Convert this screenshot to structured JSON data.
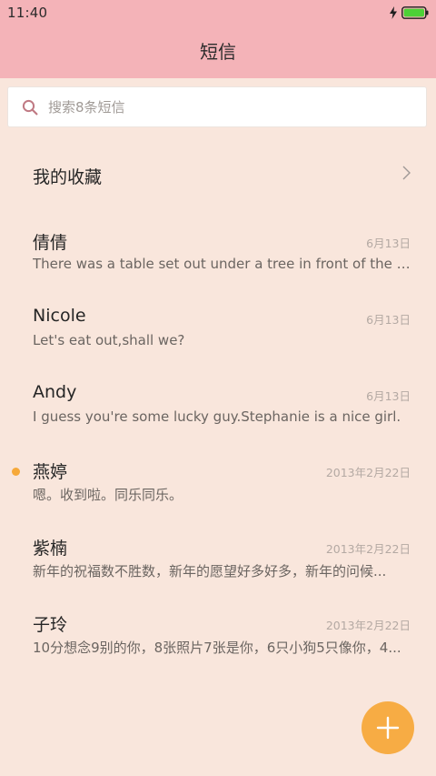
{
  "status_bar": {
    "time": "11:40",
    "icons": [
      "charging-icon",
      "battery-icon"
    ],
    "battery_color": "#4cd137"
  },
  "header": {
    "title": "短信",
    "background": "#f4b3b8"
  },
  "search": {
    "placeholder": "搜索8条短信",
    "icon": "search-icon"
  },
  "favorites": {
    "label": "我的收藏",
    "icon": "chevron-right-icon"
  },
  "conversations": [
    {
      "name": "倩倩",
      "date": "6月13日",
      "preview": "There was a table set out under a tree in front of the ho...",
      "unread": false
    },
    {
      "name": "Nicole",
      "date": "6月13日",
      "preview": "Let's eat out,shall we?",
      "unread": false
    },
    {
      "name": "Andy",
      "date": "6月13日",
      "preview": "I guess you're some lucky guy.Stephanie is a nice girl.",
      "unread": false
    },
    {
      "name": "燕婷",
      "date": "2013年2月22日",
      "preview": "嗯。收到啦。同乐同乐。",
      "unread": true
    },
    {
      "name": "紫楠",
      "date": "2013年2月22日",
      "preview": "新年的祝福数不胜数，新年的愿望好多好多，新年的问候...",
      "unread": false
    },
    {
      "name": "子玲",
      "date": "2013年2月22日",
      "preview": "10分想念9别的你，8张照片7张是你，6只小狗5只像你，4...",
      "unread": false
    }
  ],
  "fab": {
    "icon": "plus-icon",
    "color": "#f7ac44"
  },
  "colors": {
    "background": "#f9e6dc",
    "unread_dot": "#f6a93a",
    "date_text": "#b4a9a3"
  }
}
